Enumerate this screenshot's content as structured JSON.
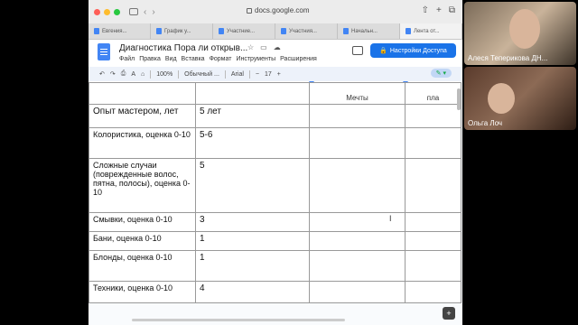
{
  "browser": {
    "url": "docs.google.com",
    "tabs": [
      {
        "label": "Евгения..."
      },
      {
        "label": "График у..."
      },
      {
        "label": "Участние..."
      },
      {
        "label": "Участния..."
      },
      {
        "label": "Начальн..."
      },
      {
        "label": "Лента от..."
      }
    ]
  },
  "doc": {
    "title": "Диагностика Пора ли открыв...",
    "menu": [
      "Файл",
      "Правка",
      "Вид",
      "Вставка",
      "Формат",
      "Инструменты",
      "Расширения"
    ],
    "share_label": "Настройки Доступа",
    "zoom": "100%",
    "style": "Обычный ...",
    "font": "Arial",
    "font_size": "17"
  },
  "table": {
    "header": [
      "",
      "",
      "Мечты",
      "пла"
    ],
    "rows": [
      {
        "label": "Опыт мастером, лет",
        "value": "5 лет"
      },
      {
        "label": "Колористика, оценка 0-10",
        "value": "5-6"
      },
      {
        "label": "Сложные случаи (поврежденные волос, пятна, полосы), оценка 0-10",
        "value": "5"
      },
      {
        "label": "Смывки, оценка 0-10",
        "value": "3"
      },
      {
        "label": "Бани, оценка 0-10",
        "value": "1"
      },
      {
        "label": "Блонды, оценка 0-10",
        "value": "1"
      },
      {
        "label": "Техники, оценка 0-10",
        "value": "4"
      }
    ]
  },
  "video": {
    "p1": "Алеся Теперикова ДН...",
    "p2": "Ольга Лоч"
  }
}
